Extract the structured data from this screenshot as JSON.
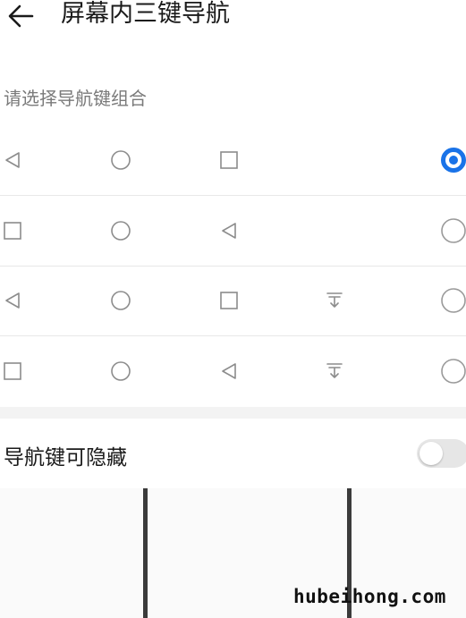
{
  "header": {
    "title": "屏幕内三键导航"
  },
  "section_label": "请选择导航键组合",
  "combinations": [
    {
      "keys": [
        "back-icon",
        "home-icon",
        "recent-icon"
      ],
      "selected": true
    },
    {
      "keys": [
        "recent-icon",
        "home-icon",
        "back-icon"
      ],
      "selected": false
    },
    {
      "keys": [
        "back-icon",
        "home-icon",
        "recent-icon",
        "notification-icon"
      ],
      "selected": false
    },
    {
      "keys": [
        "recent-icon",
        "home-icon",
        "back-icon",
        "notification-icon"
      ],
      "selected": false
    }
  ],
  "hide_nav_keys": {
    "label": "导航键可隐藏",
    "enabled": false
  },
  "colors": {
    "accent": "#1a73e8",
    "icon_gray": "#8c8c8c",
    "radio_off": "#9a9a9a",
    "toggle_off": "#e6e6e6"
  },
  "watermark": "hubeihong.com"
}
